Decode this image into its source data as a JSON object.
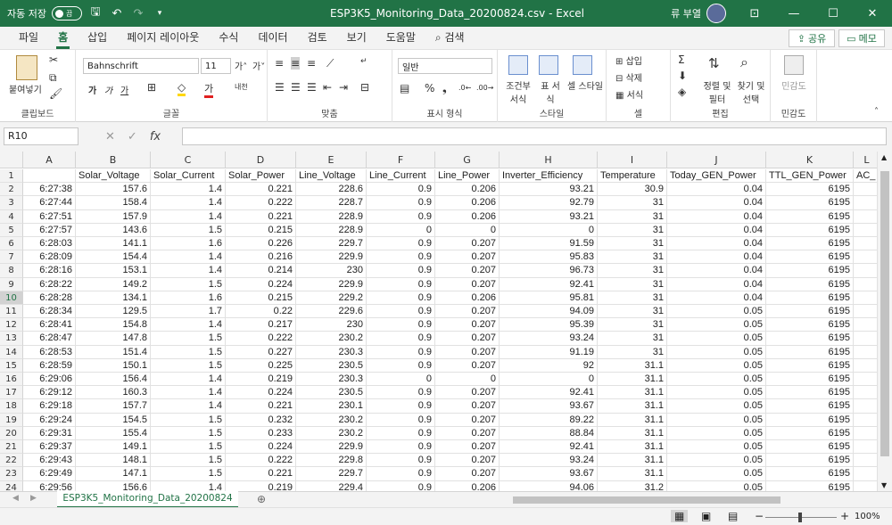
{
  "titlebar": {
    "autosave_label": "자동 저장",
    "autosave_state": "끔",
    "filename": "ESP3K5_Monitoring_Data_20200824.csv",
    "app": "Excel",
    "user": "류 부열"
  },
  "tabs": [
    "파일",
    "홈",
    "삽입",
    "페이지 레이아웃",
    "수식",
    "데이터",
    "검토",
    "보기",
    "도움말",
    "검색"
  ],
  "share_label": "공유",
  "memo_label": "메모",
  "ribbon": {
    "clipboard": {
      "paste": "붙여넣기",
      "label": "클립보드"
    },
    "font": {
      "name": "Bahnschrift",
      "size": "11",
      "bold": "가",
      "italic": "가",
      "underline": "가",
      "label": "글꼴"
    },
    "align": {
      "label": "맞춤"
    },
    "number": {
      "format": "일반",
      "label": "표시 형식"
    },
    "styles": {
      "cond": "조건부 서식",
      "table": "표 서식",
      "cell": "셀 스타일",
      "label": "스타일"
    },
    "cells": {
      "insert": "삽입",
      "delete": "삭제",
      "format": "서식",
      "label": "셀"
    },
    "editing": {
      "sort": "정렬 및 필터",
      "find": "찾기 및 선택",
      "label": "편집"
    },
    "sensitivity": {
      "name": "민감도",
      "label": "민감도"
    }
  },
  "formula_bar": {
    "namebox": "R10",
    "fx": "fx",
    "value": ""
  },
  "sheet": {
    "columns": [
      "A",
      "B",
      "C",
      "D",
      "E",
      "F",
      "G",
      "H",
      "I",
      "J",
      "K",
      "L"
    ],
    "headers": [
      "",
      "Solar_Voltage",
      "Solar_Current",
      "Solar_Power",
      "Line_Voltage",
      "Line_Current",
      "Line_Power",
      "Inverter_Efficiency",
      "Temperature",
      "Today_GEN_Power",
      "TTL_GEN_Power",
      "AC_"
    ],
    "rows": [
      [
        "6:27:38",
        "157.6",
        "1.4",
        "0.221",
        "228.6",
        "0.9",
        "0.206",
        "93.21",
        "30.9",
        "0.04",
        "6195"
      ],
      [
        "6:27:44",
        "158.4",
        "1.4",
        "0.222",
        "228.7",
        "0.9",
        "0.206",
        "92.79",
        "31",
        "0.04",
        "6195"
      ],
      [
        "6:27:51",
        "157.9",
        "1.4",
        "0.221",
        "228.9",
        "0.9",
        "0.206",
        "93.21",
        "31",
        "0.04",
        "6195"
      ],
      [
        "6:27:57",
        "143.6",
        "1.5",
        "0.215",
        "228.9",
        "0",
        "0",
        "0",
        "31",
        "0.04",
        "6195"
      ],
      [
        "6:28:03",
        "141.1",
        "1.6",
        "0.226",
        "229.7",
        "0.9",
        "0.207",
        "91.59",
        "31",
        "0.04",
        "6195"
      ],
      [
        "6:28:09",
        "154.4",
        "1.4",
        "0.216",
        "229.9",
        "0.9",
        "0.207",
        "95.83",
        "31",
        "0.04",
        "6195"
      ],
      [
        "6:28:16",
        "153.1",
        "1.4",
        "0.214",
        "230",
        "0.9",
        "0.207",
        "96.73",
        "31",
        "0.04",
        "6195"
      ],
      [
        "6:28:22",
        "149.2",
        "1.5",
        "0.224",
        "229.9",
        "0.9",
        "0.207",
        "92.41",
        "31",
        "0.04",
        "6195"
      ],
      [
        "6:28:28",
        "134.1",
        "1.6",
        "0.215",
        "229.2",
        "0.9",
        "0.206",
        "95.81",
        "31",
        "0.04",
        "6195"
      ],
      [
        "6:28:34",
        "129.5",
        "1.7",
        "0.22",
        "229.6",
        "0.9",
        "0.207",
        "94.09",
        "31",
        "0.05",
        "6195"
      ],
      [
        "6:28:41",
        "154.8",
        "1.4",
        "0.217",
        "230",
        "0.9",
        "0.207",
        "95.39",
        "31",
        "0.05",
        "6195"
      ],
      [
        "6:28:47",
        "147.8",
        "1.5",
        "0.222",
        "230.2",
        "0.9",
        "0.207",
        "93.24",
        "31",
        "0.05",
        "6195"
      ],
      [
        "6:28:53",
        "151.4",
        "1.5",
        "0.227",
        "230.3",
        "0.9",
        "0.207",
        "91.19",
        "31",
        "0.05",
        "6195"
      ],
      [
        "6:28:59",
        "150.1",
        "1.5",
        "0.225",
        "230.5",
        "0.9",
        "0.207",
        "92",
        "31.1",
        "0.05",
        "6195"
      ],
      [
        "6:29:06",
        "156.4",
        "1.4",
        "0.219",
        "230.3",
        "0",
        "0",
        "0",
        "31.1",
        "0.05",
        "6195"
      ],
      [
        "6:29:12",
        "160.3",
        "1.4",
        "0.224",
        "230.5",
        "0.9",
        "0.207",
        "92.41",
        "31.1",
        "0.05",
        "6195"
      ],
      [
        "6:29:18",
        "157.7",
        "1.4",
        "0.221",
        "230.1",
        "0.9",
        "0.207",
        "93.67",
        "31.1",
        "0.05",
        "6195"
      ],
      [
        "6:29:24",
        "154.5",
        "1.5",
        "0.232",
        "230.2",
        "0.9",
        "0.207",
        "89.22",
        "31.1",
        "0.05",
        "6195"
      ],
      [
        "6:29:31",
        "155.4",
        "1.5",
        "0.233",
        "230.2",
        "0.9",
        "0.207",
        "88.84",
        "31.1",
        "0.05",
        "6195"
      ],
      [
        "6:29:37",
        "149.1",
        "1.5",
        "0.224",
        "229.9",
        "0.9",
        "0.207",
        "92.41",
        "31.1",
        "0.05",
        "6195"
      ],
      [
        "6:29:43",
        "148.1",
        "1.5",
        "0.222",
        "229.8",
        "0.9",
        "0.207",
        "93.24",
        "31.1",
        "0.05",
        "6195"
      ],
      [
        "6:29:49",
        "147.1",
        "1.5",
        "0.221",
        "229.7",
        "0.9",
        "0.207",
        "93.67",
        "31.1",
        "0.05",
        "6195"
      ],
      [
        "6:29:56",
        "156.6",
        "1.4",
        "0.219",
        "229.4",
        "0.9",
        "0.206",
        "94.06",
        "31.2",
        "0.05",
        "6195"
      ]
    ]
  },
  "sheet_tab": "ESP3K5_Monitoring_Data_20200824",
  "status": {
    "zoom": "100%"
  }
}
